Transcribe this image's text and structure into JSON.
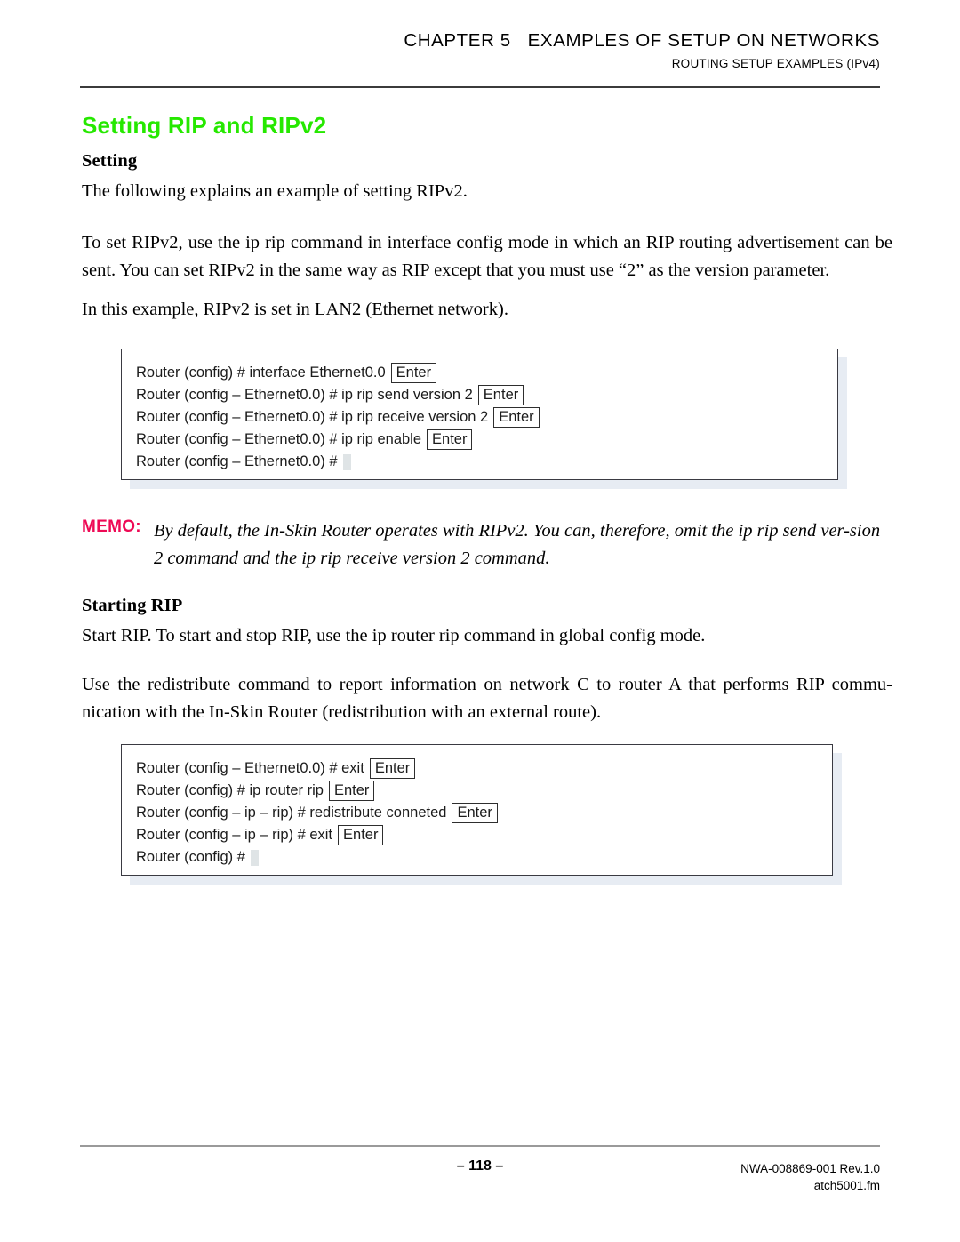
{
  "header": {
    "chapter": "CHAPTER 5   EXAMPLES OF SETUP ON NETWORKS",
    "subtitle": "ROUTING SETUP EXAMPLES (IPv4)"
  },
  "title": "Setting RIP and RIPv2",
  "colors": {
    "title_green": "#26e800",
    "memo_magenta": "#ee0a55",
    "rule_dark": "#3b3b3b",
    "rule_light": "#9a9a9a",
    "box_border": "#3a3a42",
    "box_shadow": "#e7ecf3",
    "cursor": "#dfe4e6"
  },
  "sections": {
    "setting": {
      "heading": "Setting",
      "p1": "The following explains an example of setting RIPv2.",
      "p2": "To set RIPv2, use the ip rip command in interface config mode in which an RIP routing advertisement can be sent. You can set RIPv2 in the same way as RIP except that you must use “2” as the version parameter.",
      "p3": "In this example, RIPv2 is set in LAN2 (Ethernet network)."
    },
    "starting_rip": {
      "heading": "Starting RIP",
      "p1": "Start RIP. To start and stop RIP, use the ip router rip command in global config mode.",
      "p2": "Use the redistribute command to report information on network C to router A that performs RIP commu-nication with the In-Skin Router (redistribution with an external route)."
    }
  },
  "memo": {
    "label": "MEMO:",
    "text": "By default, the In-Skin Router operates with RIPv2. You can, therefore, omit the ip rip send ver-sion 2 command and the ip rip receive version 2 command."
  },
  "console1": {
    "key_label": "Enter",
    "lines": [
      {
        "text": "Router (config) # interface Ethernet0.0",
        "key": "Enter",
        "cursor": false
      },
      {
        "text": "Router (config – Ethernet0.0) # ip rip send version 2",
        "key": "Enter",
        "cursor": false
      },
      {
        "text": "Router (config – Ethernet0.0) # ip rip receive version 2",
        "key": "Enter",
        "cursor": false
      },
      {
        "text": "Router (config – Ethernet0.0) # ip rip enable",
        "key": "Enter",
        "cursor": false
      },
      {
        "text": "Router (config – Ethernet0.0) #",
        "key": null,
        "cursor": true
      }
    ]
  },
  "console2": {
    "key_label": "Enter",
    "lines": [
      {
        "text": "Router (config – Ethernet0.0) # exit",
        "key": "Enter",
        "cursor": false
      },
      {
        "text": "Router (config) # ip router rip",
        "key": "Enter",
        "cursor": false
      },
      {
        "text": "Router (config – ip – rip) # redistribute conneted",
        "key": "Enter",
        "cursor": false
      },
      {
        "text": "Router (config – ip – rip) # exit",
        "key": "Enter",
        "cursor": false
      },
      {
        "text": "Router (config) #",
        "key": null,
        "cursor": true
      }
    ]
  },
  "footer": {
    "page": "– 118 –",
    "doc_id": "NWA-008869-001 Rev.1.0",
    "file_name": "atch5001.fm"
  }
}
